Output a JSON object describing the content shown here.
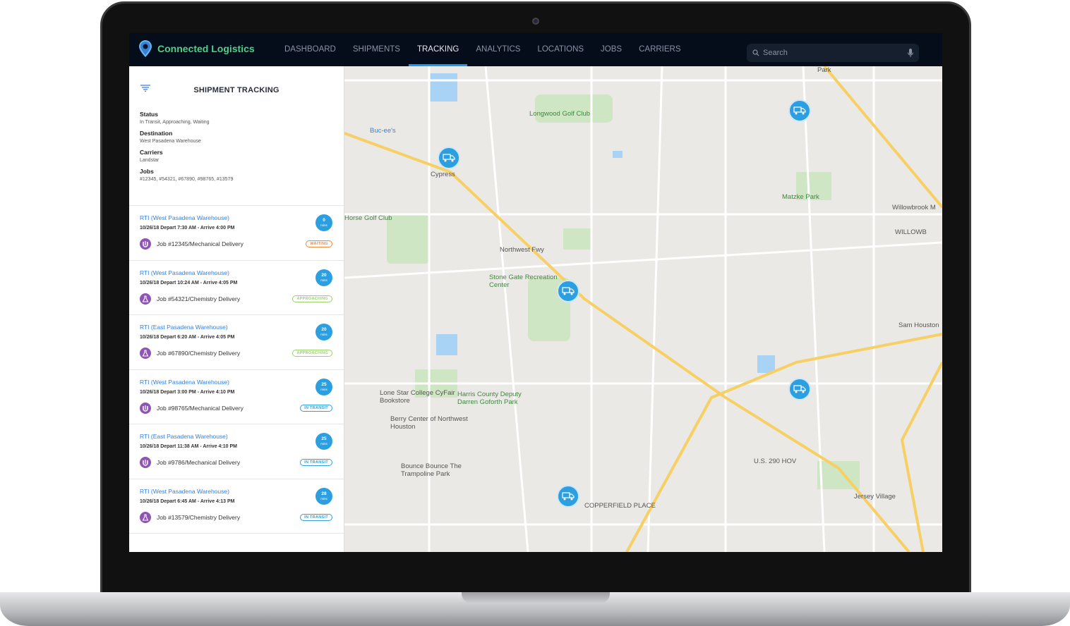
{
  "app": {
    "title": "Connected Logistics"
  },
  "nav": {
    "tabs": [
      "DASHBOARD",
      "SHIPMENTS",
      "TRACKING",
      "ANALYTICS",
      "LOCATIONS",
      "JOBS",
      "CARRIERS"
    ],
    "active": "TRACKING"
  },
  "search": {
    "placeholder": "Search"
  },
  "sidebar": {
    "title": "SHIPMENT TRACKING",
    "filters": [
      {
        "label": "Status",
        "value": "In Transit, Approaching, Waiting"
      },
      {
        "label": "Destination",
        "value": "West Pasadena Warehouse"
      },
      {
        "label": "Carriers",
        "value": "Landstar"
      },
      {
        "label": "Jobs",
        "value": "#12345, #54321, #67890, #98765, #13579"
      }
    ],
    "shipments": [
      {
        "title": "RTI (West Pasadena Warehouse)",
        "date": "10/26/18  Depart 7:30 AM - Arrive 4:00 PM",
        "job": "Job #12345/Mechanical Delivery",
        "type": "mechanical",
        "eta": "0",
        "eta_unit": "mins",
        "status": "WAITING"
      },
      {
        "title": "RTI (West Pasadena Warehouse)",
        "date": "10/26/18  Depart 10:24 AM - Arrive 4:05 PM",
        "job": "Job #54321/Chemistry Delivery",
        "type": "chemistry",
        "eta": "20",
        "eta_unit": "mins",
        "status": "APPROACHING"
      },
      {
        "title": "RTI (East Pasadena Warehouse)",
        "date": "10/26/18  Depart 6:20 AM - Arrive 4:05 PM",
        "job": "Job #67890/Chemistry Delivery",
        "type": "chemistry",
        "eta": "20",
        "eta_unit": "mins",
        "status": "APPROACHING"
      },
      {
        "title": "RTI (West Pasadena Warehouse)",
        "date": "10/26/18  Depart 3:00 PM - Arrive 4:10 PM",
        "job": "Job #98765/Mechanical Delivery",
        "type": "mechanical",
        "eta": "25",
        "eta_unit": "mins",
        "status": "IN TRANSIT"
      },
      {
        "title": "RTI (East Pasadena Warehouse)",
        "date": "10/26/18  Depart 11:38 AM - Arrive 4:10 PM",
        "job": "Job #9786/Mechanical Delivery",
        "type": "mechanical",
        "eta": "25",
        "eta_unit": "mins",
        "status": "IN TRANSIT"
      },
      {
        "title": "RTI (West Pasadena Warehouse)",
        "date": "10/26/18  Depart 6:45 AM - Arrive 4:13 PM",
        "job": "Job #13579/Chemistry Delivery",
        "type": "chemistry",
        "eta": "28",
        "eta_unit": "mins",
        "status": "IN TRANSIT"
      }
    ]
  },
  "status_colors": {
    "WAITING": "#f0883a",
    "APPROACHING": "#9ad36a",
    "IN TRANSIT": "#2f9fe0"
  },
  "map": {
    "labels": [
      "Buc-ee's",
      "Cypress",
      "Longwood Golf Club",
      "Matzke Park",
      "Horse Golf Club",
      "Stone Gate Recreation Center",
      "Lone Star College CyFair Bookstore",
      "Harris County Deputy Darren Goforth Park",
      "Berry Center of Northwest Houston",
      "Bounce Bounce The Trampoline Park",
      "COPPERFIELD PLACE",
      "Jersey Village",
      "Sam Houston",
      "Willowbrook M",
      "WILLOWB",
      "Park",
      "Northwest Fwy",
      "U.S. 290 HOV"
    ],
    "markers": 5
  }
}
